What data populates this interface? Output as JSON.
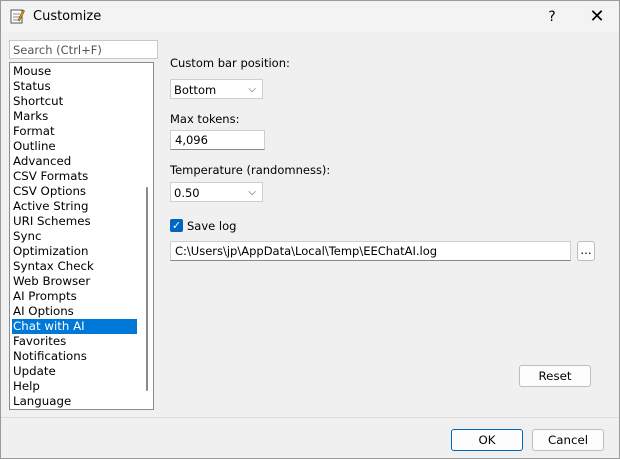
{
  "window": {
    "title": "Customize",
    "help_glyph": "?",
    "close_glyph": "✕"
  },
  "search": {
    "placeholder": "Search (Ctrl+F)"
  },
  "sidebar": {
    "items": [
      "Mouse",
      "Status",
      "Shortcut",
      "Marks",
      "Format",
      "Outline",
      "Advanced",
      "CSV Formats",
      "CSV Options",
      "Active String",
      "URI Schemes",
      "Sync",
      "Optimization",
      "Syntax Check",
      "Web Browser",
      "AI Prompts",
      "AI Options",
      "Chat with AI",
      "Favorites",
      "Notifications",
      "Update",
      "Help",
      "Language"
    ],
    "selected": "Chat with AI"
  },
  "settings": {
    "bar_position_label": "Custom bar position:",
    "bar_position_value": "Bottom",
    "max_tokens_label": "Max tokens:",
    "max_tokens_value": "4,096",
    "temperature_label": "Temperature (randomness):",
    "temperature_value": "0.50",
    "save_log_label": "Save log",
    "save_log_checked": true,
    "log_path": "C:\\Users\\jp\\AppData\\Local\\Temp\\EEChatAI.log",
    "browse_label": "...",
    "reset_label": "Reset"
  },
  "footer": {
    "ok_label": "OK",
    "cancel_label": "Cancel"
  },
  "colors": {
    "accent": "#0078d7",
    "checkbox": "#0067c0"
  }
}
